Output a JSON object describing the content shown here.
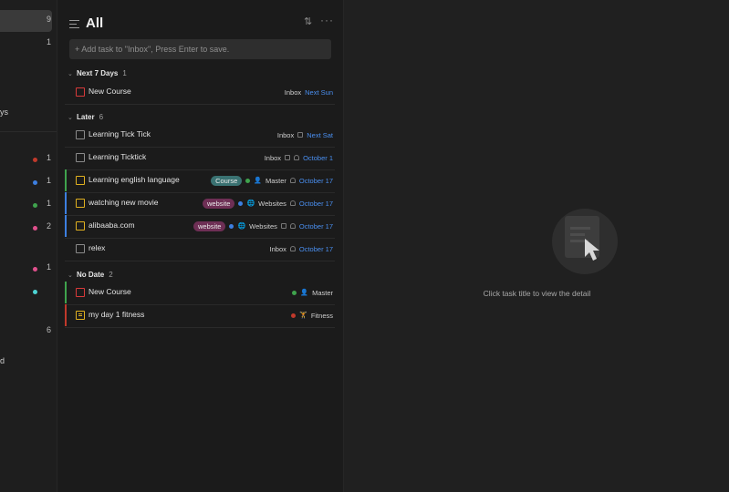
{
  "sidebar": {
    "rows": [
      {
        "count": "9",
        "active": true
      },
      {
        "count": "1"
      },
      {
        "text": "ys"
      },
      {
        "count": "1",
        "dot": "#c0392b"
      },
      {
        "count": "1",
        "dot": "#3d7fe0"
      },
      {
        "count": "1",
        "dot": "#3fa34d"
      },
      {
        "count": "2",
        "dot": "#e0508c"
      },
      {
        "count": "1",
        "dot": "#e0508c"
      },
      {
        "dot": "#4dd4d4"
      },
      {
        "count": "6"
      },
      {
        "text": "d"
      }
    ]
  },
  "header": {
    "title": "All",
    "sort_icon": "sort-icon",
    "more_icon": "more-icon"
  },
  "add_task": {
    "placeholder": "+ Add task to \"Inbox\", Press Enter to save."
  },
  "sections": [
    {
      "name": "Next 7 Days",
      "count": "1"
    },
    {
      "name": "Later",
      "count": "6"
    },
    {
      "name": "No Date",
      "count": "2"
    }
  ],
  "tasks": [
    {
      "title": "New Course",
      "list": "Inbox",
      "date": "Next Sun",
      "checkbox_color": "#d83a3a"
    },
    {
      "title": "Learning Tick Tick",
      "list": "Inbox",
      "date": "Next Sat",
      "checkbox_color": "#8a8a8a"
    },
    {
      "title": "Learning Ticktick",
      "list": "Inbox",
      "date": "October 1",
      "checkbox_color": "#8a8a8a"
    },
    {
      "title": "Learning english language",
      "tag": "Course",
      "tag_color": "#3a7272",
      "list": "Master",
      "list_icon": "person-icon",
      "list_dot": "#3fa34d",
      "date": "October 17",
      "checkbox_color": "#e0b020",
      "bar_color": "#3fa34d"
    },
    {
      "title": "watching new movie",
      "tag": "website",
      "tag_color": "#6e2f55",
      "list": "Websites",
      "list_icon": "globe-icon",
      "list_dot": "#3d7fe0",
      "date": "October 17",
      "checkbox_color": "#e0b020",
      "bar_color": "#3d7fe0"
    },
    {
      "title": "alibaaba.com",
      "tag": "website",
      "tag_color": "#6e2f55",
      "list": "Websites",
      "list_icon": "globe-icon",
      "list_dot": "#3d7fe0",
      "date": "October 17",
      "checkbox_color": "#e0b020",
      "bar_color": "#3d7fe0"
    },
    {
      "title": "relex",
      "list": "Inbox",
      "date": "October 17",
      "checkbox_color": "#8a8a8a"
    },
    {
      "title": "New Course",
      "list": "Master",
      "list_icon": "person-icon",
      "list_dot": "#3fa34d",
      "checkbox_color": "#d83a3a",
      "bar_color": "#3fa34d"
    },
    {
      "title": "my day 1 fitness",
      "list": "Fitness",
      "list_icon": "dumbbell-icon",
      "list_dot": "#c0392b",
      "checkbox_color": "#e0b020",
      "checkbox_type": "note",
      "bar_color": "#c0392b"
    }
  ],
  "detail": {
    "empty_text": "Click task title to view the detail",
    "empty_icon": "cursor-click-icon"
  }
}
